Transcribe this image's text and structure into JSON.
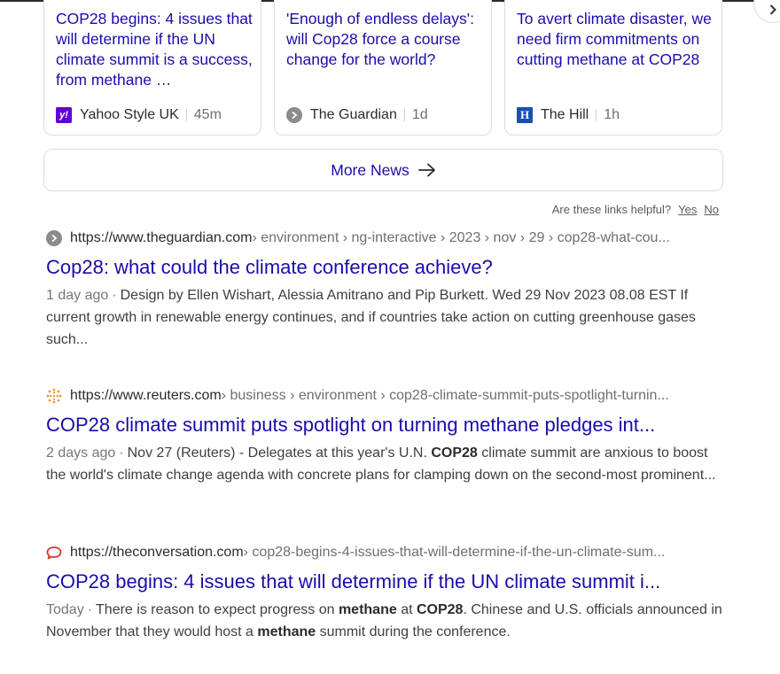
{
  "news_cards": [
    {
      "title": "COP28 begins: 4 issues that will determine if the UN climate summit is a success, from methane …",
      "source": "Yahoo Style UK",
      "source_icon": "yahoo-icon",
      "time": "45m",
      "accent": "#6001d2"
    },
    {
      "title": "'Enough of endless delays': will Cop28 force a course change for the world?",
      "source": "The Guardian",
      "source_icon": "guardian-icon",
      "time": "1d",
      "accent": "#8b8b8b"
    },
    {
      "title": "To avert climate disaster, we need firm commitments on cutting methane at COP28",
      "source": "The Hill",
      "source_icon": "hill-icon",
      "time": "1h",
      "accent": "#1a4fad"
    }
  ],
  "more_news": {
    "label": "More News",
    "icon": "arrow-right-icon"
  },
  "feedback": {
    "question": "Are these links helpful?",
    "yes": "Yes",
    "no": "No"
  },
  "results": [
    {
      "favicon": "guardian-icon",
      "host": "https://www.theguardian.com",
      "path": " › environment › ng-interactive › 2023 › nov › 29 › cop28-what-cou...",
      "title": "Cop28: what could the climate conference achieve?",
      "date": "1 day ago",
      "snippet_parts": [
        {
          "text": "Design by Ellen Wishart, Alessia Amitrano and Pip Burkett. Wed 29 Nov 2023 08.08 EST If current growth in renewable energy continues, and if countries take action on cutting greenhouse gases such...",
          "bold": false
        }
      ]
    },
    {
      "favicon": "reuters-icon",
      "host": "https://www.reuters.com",
      "path": " › business › environment › cop28-climate-summit-puts-spotlight-turnin...",
      "title": "COP28 climate summit puts spotlight on turning methane pledges int...",
      "date": "2 days ago",
      "snippet_parts": [
        {
          "text": "Nov 27 (Reuters) - Delegates at this year's U.N. ",
          "bold": false
        },
        {
          "text": "COP28",
          "bold": true
        },
        {
          "text": " climate summit are anxious to boost the world's climate change agenda with concrete plans for clamping down on the second-most prominent...",
          "bold": false
        }
      ]
    },
    {
      "favicon": "conversation-icon",
      "host": "https://theconversation.com",
      "path": " › cop28-begins-4-issues-that-will-determine-if-the-un-climate-sum...",
      "title": "COP28 begins: 4 issues that will determine if the UN climate summit i...",
      "date": "Today",
      "snippet_parts": [
        {
          "text": "There is reason to expect progress on ",
          "bold": false
        },
        {
          "text": "methane",
          "bold": true
        },
        {
          "text": " at ",
          "bold": false
        },
        {
          "text": "COP28",
          "bold": true
        },
        {
          "text": ". Chinese and U.S. officials announced in November that they would host a ",
          "bold": false
        },
        {
          "text": "methane",
          "bold": true
        },
        {
          "text": " summit during the conference.",
          "bold": false
        }
      ]
    }
  ],
  "colors": {
    "link": "#1a0dab",
    "muted": "#6f6f6f",
    "border": "#dcdcdc"
  }
}
